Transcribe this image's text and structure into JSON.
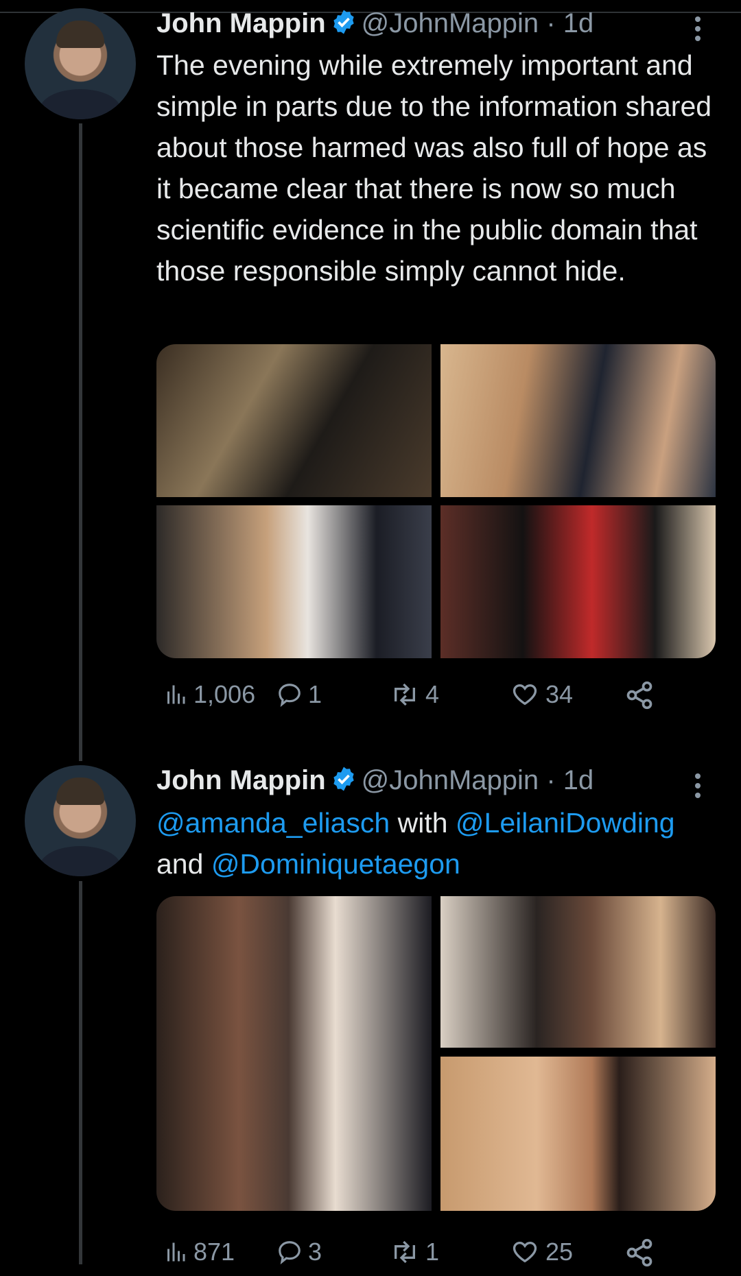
{
  "tweets": [
    {
      "author": {
        "name": "John Mappin",
        "handle": "@JohnMappin",
        "separator": "·",
        "time": "1d"
      },
      "text_plain": "The evening while extremely important and simple in parts due to the information shared about those harmed was also full of hope as it became clear that there is now so much scientific evidence in the public domain that those responsible simply cannot hide.",
      "media": [
        {
          "description": "group-at-event-photo"
        },
        {
          "description": "selfie-three-people-photo"
        },
        {
          "description": "couple-seated-photo"
        },
        {
          "description": "three-women-standing-photo"
        }
      ],
      "stats": {
        "views": "1,006",
        "replies": "1",
        "retweets": "4",
        "likes": "34"
      }
    },
    {
      "author": {
        "name": "John Mappin",
        "handle": "@JohnMappin",
        "separator": "·",
        "time": "1d"
      },
      "text_parts": {
        "m1": "@amanda_eliasch",
        "w1": " with ",
        "m2": "@LeilaniDowding",
        "w2": "and ",
        "m3": "@Dominiquetaegon"
      },
      "media": [
        {
          "description": "two-women-selfie-photo"
        },
        {
          "description": "three-women-group-photo"
        },
        {
          "description": "two-women-closeup-photo"
        }
      ],
      "stats": {
        "views": "871",
        "replies": "3",
        "retweets": "1",
        "likes": "25"
      }
    }
  ],
  "colors": {
    "background": "#000000",
    "text": "#e7e9ea",
    "muted": "#8b98a5",
    "accent": "#1d9bf0",
    "line": "#333639"
  }
}
